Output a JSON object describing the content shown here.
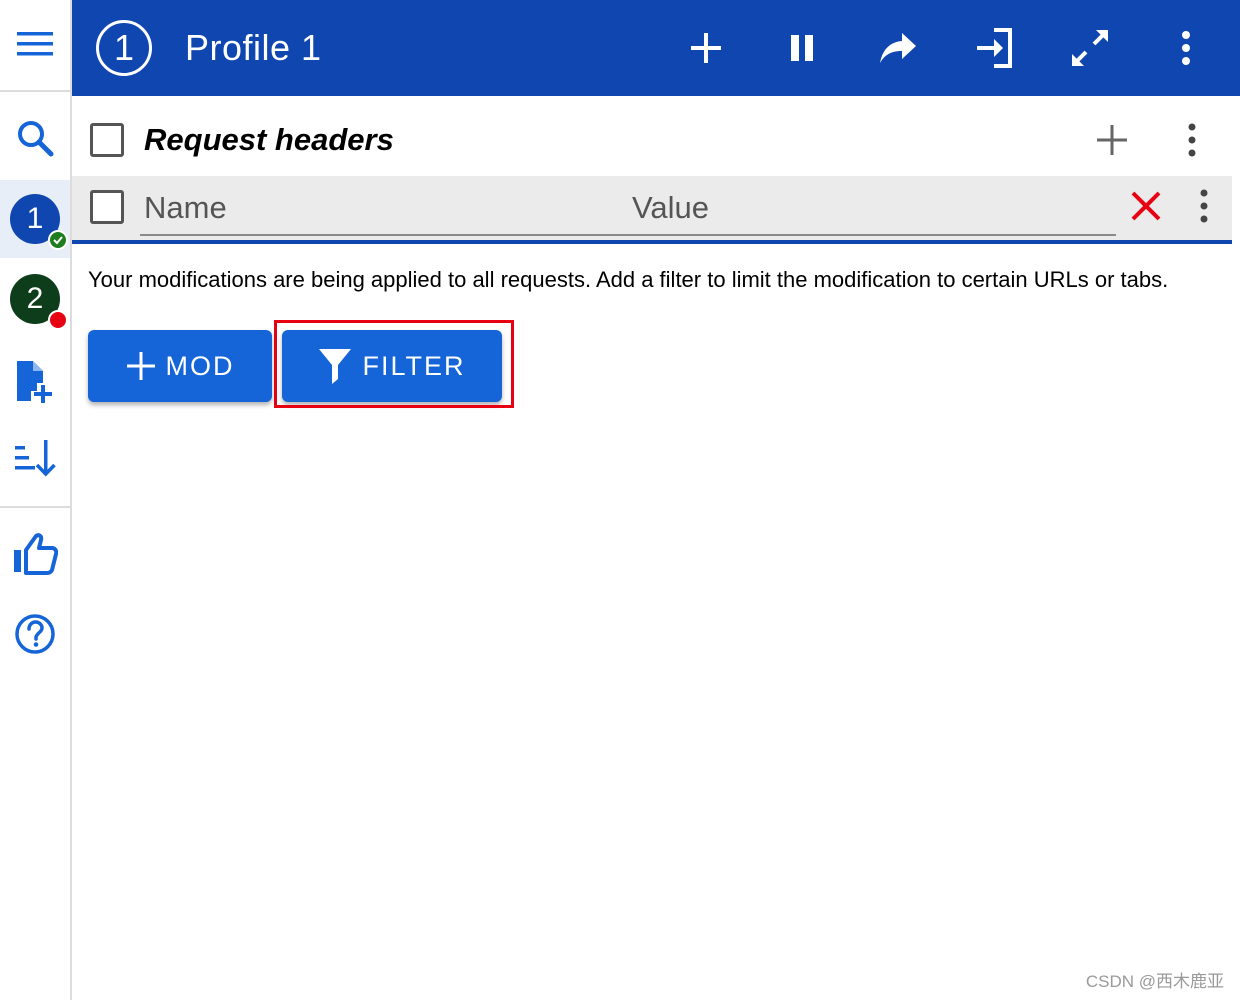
{
  "sidebar": {
    "items": [
      {
        "icon": "menu-icon"
      },
      {
        "icon": "search-icon"
      },
      {
        "label": "1",
        "color": "#0f46b0",
        "badge_color": "#1e7d1e",
        "badge_icon": "check-icon",
        "active": true
      },
      {
        "label": "2",
        "color": "#0d3d1b",
        "badge_color": "#e60012"
      },
      {
        "icon": "add-file-icon"
      },
      {
        "icon": "sort-icon"
      },
      {
        "icon": "thumbs-up-icon"
      },
      {
        "icon": "help-icon"
      }
    ]
  },
  "topbar": {
    "profile_number": "1",
    "title": "Profile 1",
    "color": "#0f46b0",
    "actions": [
      "add-icon",
      "pause-icon",
      "share-icon",
      "import-icon",
      "fullscreen-icon",
      "more-vert-icon"
    ]
  },
  "section": {
    "title": "Request headers",
    "actions": [
      "add-icon",
      "more-vert-icon"
    ]
  },
  "header_row": {
    "name_placeholder": "Name",
    "value_placeholder": "Value",
    "actions": [
      "close-icon",
      "more-vert-icon"
    ]
  },
  "info_text": "Your modifications are being applied to all requests. Add a filter to limit the modification to certain URLs or tabs.",
  "buttons": {
    "mod_label": "MOD",
    "filter_label": "FILTER",
    "color": "#1565d8",
    "highlight_color": "#e60012"
  },
  "watermark": "CSDN @西木鹿亚"
}
